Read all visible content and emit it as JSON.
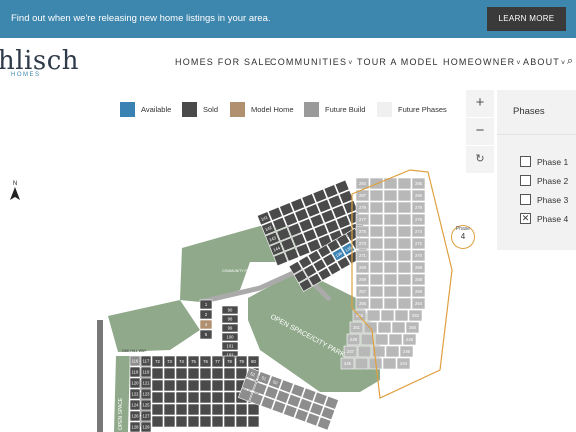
{
  "banner": {
    "message": "Find out when we're releasing new home listings in your area.",
    "button": "LEARN MORE"
  },
  "logo": {
    "name": "hlisch",
    "sub": "HOMES"
  },
  "nav": [
    {
      "label": "HOMES FOR SALE",
      "dropdown": false
    },
    {
      "label": "COMMUNITIES",
      "dropdown": true
    },
    {
      "label": "TOUR A MODEL",
      "dropdown": false
    },
    {
      "label": "HOMEOWNER",
      "dropdown": true
    },
    {
      "label": "ABOUT",
      "dropdown": true
    }
  ],
  "legend": [
    {
      "label": "Available",
      "color": "#3a82b3"
    },
    {
      "label": "Sold",
      "color": "#4a4a4a"
    },
    {
      "label": "Model Home",
      "color": "#b0906e"
    },
    {
      "label": "Future Build",
      "color": "#9a9a9a"
    },
    {
      "label": "Future Phases",
      "color": "#f0f0f0"
    }
  ],
  "zoom": {
    "in": "+",
    "out": "−",
    "reset": "↻"
  },
  "phases_panel": {
    "title": "Phases",
    "items": [
      {
        "label": "Phase 1",
        "checked": false
      },
      {
        "label": "Phase 2",
        "checked": false
      },
      {
        "label": "Phase 3",
        "checked": false
      },
      {
        "label": "Phase 4",
        "checked": true
      }
    ]
  },
  "map": {
    "north": "N",
    "phase_badge": {
      "label": "Phase",
      "number": "4"
    },
    "park_label": "OPEN SPACE/CITY PARK",
    "community_pavilion": "COMMUNITY PAVILION",
    "open_space_left": "OPEN SPACE",
    "street_labels": [
      "OAK HILL WAY"
    ],
    "lots_northwest": [
      "141",
      "142",
      "143",
      "144",
      "161",
      "160",
      "159",
      "155",
      "152",
      "151",
      "150"
    ],
    "lots_middle": [
      "90",
      "98",
      "99",
      "100",
      "101",
      "102",
      "99",
      "14",
      "1",
      "2",
      "4",
      "5",
      "3"
    ],
    "lots_left_cluster": [
      "71",
      "72",
      "73",
      "74",
      "75",
      "76",
      "77",
      "78",
      "79",
      "80",
      "75",
      "70",
      "69",
      "68",
      "66",
      "65",
      "61",
      "52",
      "51",
      "50"
    ],
    "lots_left_column": [
      "116",
      "117",
      "118",
      "119",
      "120",
      "121",
      "122",
      "123",
      "124",
      "125",
      "126",
      "127",
      "128",
      "129",
      "130",
      "131",
      "132",
      "133",
      "134",
      "135",
      "136",
      "137",
      "138",
      "139",
      "140"
    ],
    "lots_phase4": [
      "284",
      "285",
      "287",
      "286",
      "279",
      "278",
      "277",
      "276",
      "275",
      "274",
      "273",
      "272",
      "271",
      "270",
      "269",
      "268",
      "259",
      "258",
      "257",
      "256",
      "255",
      "254",
      "253",
      "252",
      "251",
      "250",
      "249",
      "248",
      "247",
      "246",
      "245",
      "244",
      "243",
      "242",
      "241"
    ],
    "lots_available": [
      "138",
      "139"
    ]
  }
}
